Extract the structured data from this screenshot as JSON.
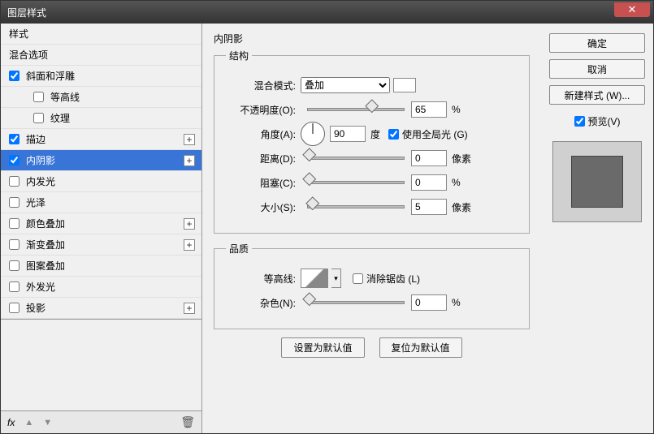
{
  "window": {
    "title": "图层样式"
  },
  "sidebar": {
    "styles_header": "样式",
    "blend_options": "混合选项",
    "items": [
      {
        "label": "斜面和浮雕",
        "checked": true,
        "expandable": false,
        "sub": false
      },
      {
        "label": "等高线",
        "checked": false,
        "expandable": false,
        "sub": true
      },
      {
        "label": "纹理",
        "checked": false,
        "expandable": false,
        "sub": true
      },
      {
        "label": "描边",
        "checked": true,
        "expandable": true,
        "sub": false
      },
      {
        "label": "内阴影",
        "checked": true,
        "expandable": true,
        "sub": false,
        "selected": true
      },
      {
        "label": "内发光",
        "checked": false,
        "expandable": false,
        "sub": false
      },
      {
        "label": "光泽",
        "checked": false,
        "expandable": false,
        "sub": false
      },
      {
        "label": "颜色叠加",
        "checked": false,
        "expandable": true,
        "sub": false
      },
      {
        "label": "渐变叠加",
        "checked": false,
        "expandable": true,
        "sub": false
      },
      {
        "label": "图案叠加",
        "checked": false,
        "expandable": false,
        "sub": false
      },
      {
        "label": "外发光",
        "checked": false,
        "expandable": false,
        "sub": false
      },
      {
        "label": "投影",
        "checked": false,
        "expandable": true,
        "sub": false
      }
    ],
    "footer": {
      "fx": "fx"
    }
  },
  "center": {
    "panel_title": "内阴影",
    "structure": {
      "legend": "结构",
      "blend_mode_label": "混合模式:",
      "blend_mode_value": "叠加",
      "opacity_label": "不透明度(O):",
      "opacity_value": "65",
      "opacity_unit": "%",
      "angle_label": "角度(A):",
      "angle_value": "90",
      "angle_unit": "度",
      "global_light_label": "使用全局光 (G)",
      "distance_label": "距离(D):",
      "distance_value": "0",
      "distance_unit": "像素",
      "choke_label": "阻塞(C):",
      "choke_value": "0",
      "choke_unit": "%",
      "size_label": "大小(S):",
      "size_value": "5",
      "size_unit": "像素"
    },
    "quality": {
      "legend": "品质",
      "contour_label": "等高线:",
      "antialias_label": "消除锯齿 (L)",
      "noise_label": "杂色(N):",
      "noise_value": "0",
      "noise_unit": "%"
    },
    "buttons": {
      "make_default": "设置为默认值",
      "reset_default": "复位为默认值"
    }
  },
  "right": {
    "ok": "确定",
    "cancel": "取消",
    "new_style": "新建样式 (W)...",
    "preview_label": "预览(V)"
  }
}
